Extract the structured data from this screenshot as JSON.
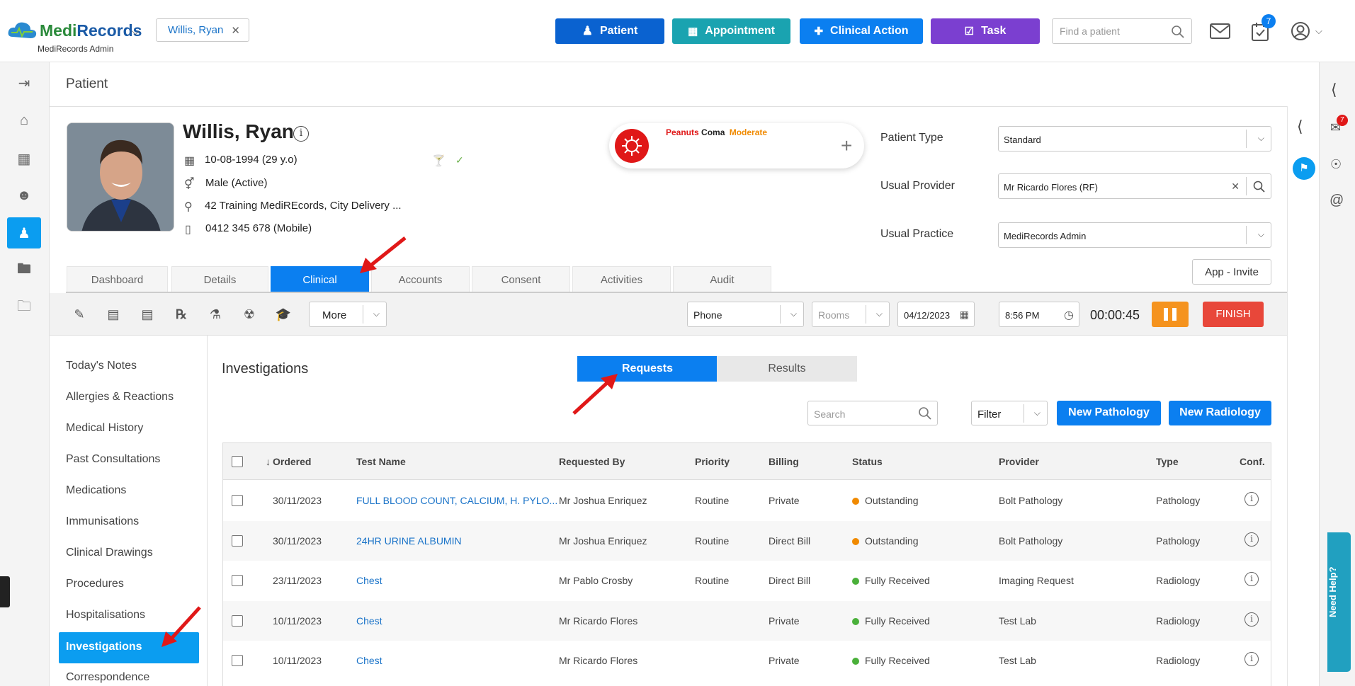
{
  "app": {
    "brand_a": "Medi",
    "brand_b": "Records",
    "subtitle": "MediRecords Admin"
  },
  "topbar": {
    "patient_chip": "Willis, Ryan",
    "buttons": [
      {
        "label": "Patient",
        "color": "#0a62d0"
      },
      {
        "label": "Appointment",
        "color": "#1aa3b0"
      },
      {
        "label": "Clinical Action",
        "color": "#0b7ff0"
      },
      {
        "label": "Task",
        "color": "#7b3fd0"
      }
    ],
    "find_placeholder": "Find a patient",
    "task_badge": "7"
  },
  "page": {
    "title": "Patient"
  },
  "patient": {
    "name": "Willis, Ryan",
    "dob": "10-08-1994 (29 y.o)",
    "gender": "Male (Active)",
    "address": "42 Training MediREcords, City Delivery ...",
    "phone": "0412 345 678 (Mobile)"
  },
  "allergy": {
    "substance": "Peanuts",
    "reaction": "Coma",
    "severity": "Moderate"
  },
  "fields": {
    "patient_type_label": "Patient Type",
    "patient_type": "Standard",
    "usual_provider_label": "Usual Provider",
    "usual_provider": "Mr Ricardo Flores (RF)",
    "usual_practice_label": "Usual Practice",
    "usual_practice": "MediRecords Admin",
    "invite": "App - Invite"
  },
  "tabs": [
    "Dashboard",
    "Details",
    "Clinical",
    "Accounts",
    "Consent",
    "Activities",
    "Audit"
  ],
  "toolbar": {
    "more": "More",
    "contact": "Phone",
    "rooms_placeholder": "Rooms",
    "date": "04/12/2023",
    "time": "8:56 PM",
    "timer": "00:00:45",
    "finish": "FINISH"
  },
  "sidenav": [
    "Today's Notes",
    "Allergies & Reactions",
    "Medical History",
    "Past Consultations",
    "Medications",
    "Immunisations",
    "Clinical Drawings",
    "Procedures",
    "Hospitalisations",
    "Investigations",
    "Correspondence"
  ],
  "investigations": {
    "title": "Investigations",
    "seg_requests": "Requests",
    "seg_results": "Results",
    "search_placeholder": "Search",
    "filter": "Filter",
    "new_pathology": "New Pathology",
    "new_radiology": "New Radiology",
    "columns": [
      "Ordered",
      "Test Name",
      "Requested By",
      "Priority",
      "Billing",
      "Status",
      "Provider",
      "Type",
      "Conf."
    ],
    "rows": [
      {
        "ordered": "30/11/2023",
        "test": "FULL BLOOD COUNT, CALCIUM, H. PYLO...",
        "by": "Mr Joshua Enriquez",
        "priority": "Routine",
        "billing": "Private",
        "status": "Outstanding",
        "status_color": "#f08a00",
        "provider": "Bolt Pathology",
        "type": "Pathology"
      },
      {
        "ordered": "30/11/2023",
        "test": "24HR URINE ALBUMIN",
        "by": "Mr Joshua Enriquez",
        "priority": "Routine",
        "billing": "Direct Bill",
        "status": "Outstanding",
        "status_color": "#f08a00",
        "provider": "Bolt Pathology",
        "type": "Pathology"
      },
      {
        "ordered": "23/11/2023",
        "test": "Chest",
        "by": "Mr Pablo Crosby",
        "priority": "Routine",
        "billing": "Direct Bill",
        "status": "Fully Received",
        "status_color": "#4ab03a",
        "provider": "Imaging Request",
        "type": "Radiology"
      },
      {
        "ordered": "10/11/2023",
        "test": "Chest",
        "by": "Mr Ricardo Flores",
        "priority": "",
        "billing": "Private",
        "status": "Fully Received",
        "status_color": "#4ab03a",
        "provider": "Test Lab",
        "type": "Radiology"
      },
      {
        "ordered": "10/11/2023",
        "test": "Chest",
        "by": "Mr Ricardo Flores",
        "priority": "",
        "billing": "Private",
        "status": "Fully Received",
        "status_color": "#4ab03a",
        "provider": "Test Lab",
        "type": "Radiology"
      }
    ]
  },
  "rightbar": {
    "badge": "7",
    "need_help": "Need Help?"
  }
}
